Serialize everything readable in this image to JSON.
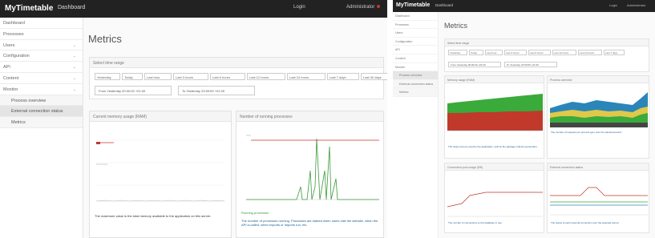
{
  "app": {
    "brand": "MyTimetable",
    "section": "Dashboard",
    "login_label": "Login",
    "user_label": "Administrator"
  },
  "sidebar": {
    "items": [
      {
        "label": "Dashboard",
        "chevron": false,
        "sub": false,
        "active": false
      },
      {
        "label": "Processes",
        "chevron": false,
        "sub": false,
        "active": false
      },
      {
        "label": "Users",
        "chevron": true,
        "sub": false,
        "active": false
      },
      {
        "label": "Configuration",
        "chevron": true,
        "sub": false,
        "active": false
      },
      {
        "label": "API",
        "chevron": true,
        "sub": false,
        "active": false
      },
      {
        "label": "Content",
        "chevron": true,
        "sub": false,
        "active": false
      },
      {
        "label": "Monitor",
        "chevron": true,
        "sub": false,
        "active": false
      },
      {
        "label": "Process overview",
        "chevron": false,
        "sub": true,
        "active": false
      },
      {
        "label": "External connection status",
        "chevron": false,
        "sub": true,
        "active": true
      },
      {
        "label": "Metrics",
        "chevron": false,
        "sub": true,
        "active": false
      }
    ]
  },
  "page": {
    "title": "Metrics"
  },
  "time_range": {
    "header": "Select time range",
    "buttons": [
      "Yesterday",
      "Today",
      "Last hour",
      "Last 3 hours",
      "Last 6 hours",
      "Last 12 hours",
      "Last 24 hours",
      "Last 7 days",
      "Last 30 days"
    ],
    "from_label": "From",
    "from_value": "Yesterday 00:00:00 +01:00",
    "to_label": "To",
    "to_value": "Yesterday 23:59:59 +01:00"
  },
  "cards": {
    "memory": {
      "header": "Current memory usage (RAM)",
      "note": "The maximum value is the total memory available to the application on this server."
    },
    "processes": {
      "header": "Number of running processes",
      "legend": "Running processes",
      "note": "The number of processes running. Processes are started when users visit the website, when the API is called, when exports or imports run, etc."
    }
  },
  "right": {
    "brand": "MyTimetable",
    "section": "Dashboard",
    "login": "Login",
    "user": "Administrator",
    "title": "Metrics",
    "sidebar": [
      "Dashboard",
      "Processes",
      "Users",
      "Configuration",
      "API",
      "Content",
      "Monitor",
      "Process overview",
      "External connection status",
      "Metrics"
    ],
    "timerange_header": "Select time range",
    "buttons": [
      "Yesterday",
      "Today",
      "Last hour",
      "Last 3 hours",
      "Last 6 hours",
      "Last 12 hours",
      "Last 24 hours",
      "Last 7 days"
    ],
    "from_value": "From Yesterday 00:00:00 +01:00",
    "to_value": "To Yesterday 23:59:59 +01:00",
    "card_titles": [
      "Memory usage (RAM)",
      "Process overview",
      "Connection pool usage (DB)",
      "External connection status"
    ],
    "card_notes": [
      "The heap memory used by the application, split by the garbage collector generation.",
      "The number of requests per process type over the selected period.",
      "The number of connections to the database in use.",
      "The status of each external connection over the selected period."
    ]
  },
  "colors": {
    "nav": "#222222",
    "red": "#c0392b",
    "green": "#3a9a3a",
    "accent": "#1c5a8f"
  }
}
